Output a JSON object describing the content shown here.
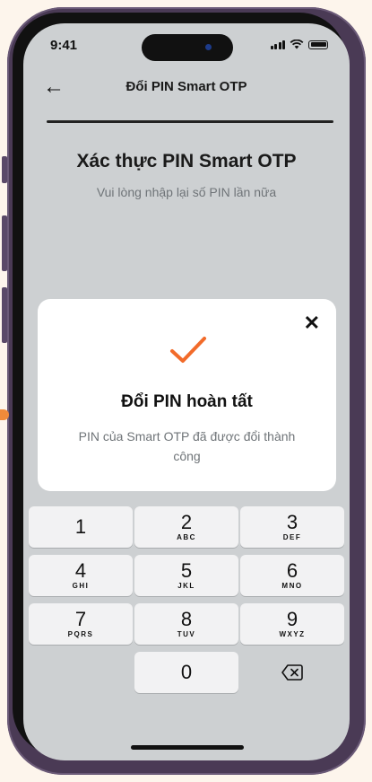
{
  "status_bar": {
    "time": "9:41"
  },
  "nav": {
    "title": "Đổi PIN Smart OTP"
  },
  "page": {
    "title": "Xác thực PIN Smart OTP",
    "subtitle": "Vui lòng nhập lại số PIN lần nữa"
  },
  "modal": {
    "title": "Đổi PIN hoàn tất",
    "message": "PIN của Smart OTP đã được đổi thành công"
  },
  "keypad": [
    {
      "num": "1",
      "letters": ""
    },
    {
      "num": "2",
      "letters": "ABC"
    },
    {
      "num": "3",
      "letters": "DEF"
    },
    {
      "num": "4",
      "letters": "GHI"
    },
    {
      "num": "5",
      "letters": "JKL"
    },
    {
      "num": "6",
      "letters": "MNO"
    },
    {
      "num": "7",
      "letters": "PQRS"
    },
    {
      "num": "8",
      "letters": "TUV"
    },
    {
      "num": "9",
      "letters": "WXYZ"
    },
    {
      "num": "0",
      "letters": ""
    }
  ],
  "colors": {
    "accent": "#f26b2a",
    "screen_bg": "#cdd0d2",
    "frame": "#4a3a55"
  }
}
